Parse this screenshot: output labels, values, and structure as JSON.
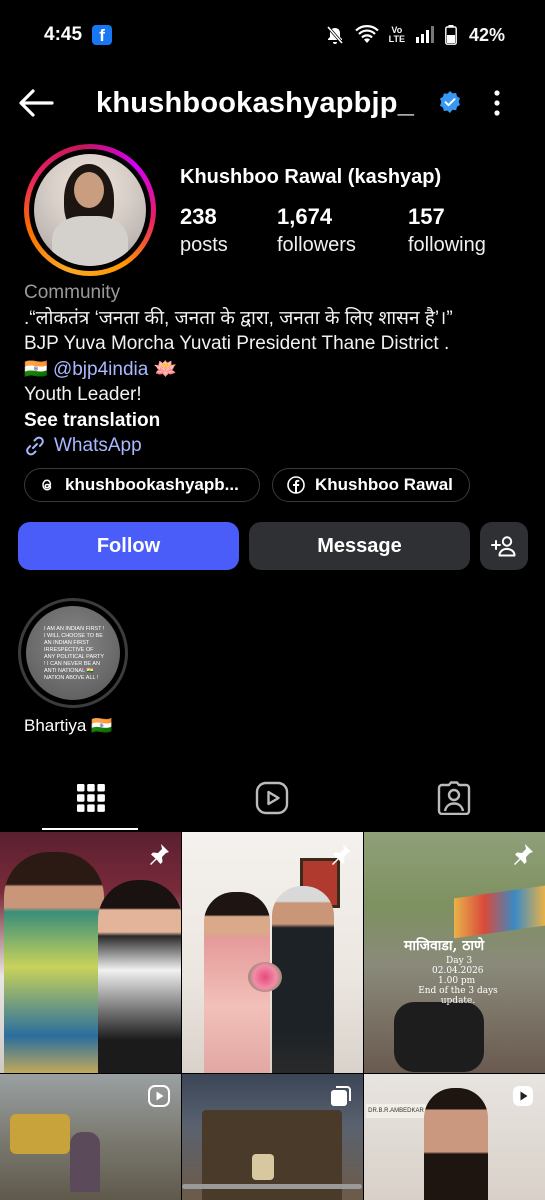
{
  "status_bar": {
    "time": "4:45",
    "app_badge": "f",
    "network_label_top": "Vo",
    "network_label_bottom": "LTE",
    "battery": "42%"
  },
  "header": {
    "username": "khushbookashyapbjp_",
    "verified": true
  },
  "profile": {
    "display_name": "Khushboo Rawal (kashyap)",
    "stats": [
      {
        "value": "238",
        "label": "posts"
      },
      {
        "value": "1,674",
        "label": "followers"
      },
      {
        "value": "157",
        "label": "following"
      }
    ],
    "category": "Community",
    "bio_line1": ".“लोकतंत्र ‘जनता की, जनता के द्वारा, जनता के लिए शासन है’।”",
    "bio_line2": "BJP Yuva Morcha Yuvati President Thane District .",
    "bio_flag": "🇮🇳",
    "bio_mention": "@bjp4india",
    "bio_lotus": "🪷",
    "bio_line4": "Youth Leader!",
    "see_translation": "See translation",
    "link_label": "WhatsApp"
  },
  "chips": {
    "threads": "khushbookashyapb...",
    "facebook": "Khushboo Rawal"
  },
  "actions": {
    "follow": "Follow",
    "message": "Message"
  },
  "highlight": {
    "label": "Bhartiya 🇮🇳",
    "cover_text": "I AM AN INDIAN FIRST ! I WILL CHOOSE TO BE AN INDIAN FIRST IRRESPECTIVE OF ANY POLITICAL PARTY ! I CAN NEVER BE AN ANTI NATIONAL 🇮🇳 NATION ABOVE ALL !"
  },
  "grid": {
    "post3_title": "माजिवाडा, ठाणे",
    "post3_day": "Day 3",
    "post3_date": "02.04.2026",
    "post3_time": "1.00 pm",
    "post3_note": "End of the 3 days update.",
    "post6_sign": "DR.B.R.AMBEDKAR"
  },
  "colors": {
    "accent": "#4a5df9",
    "link": "#a9b8ff",
    "verified": "#3897f0",
    "button_dark": "#2f3034"
  }
}
